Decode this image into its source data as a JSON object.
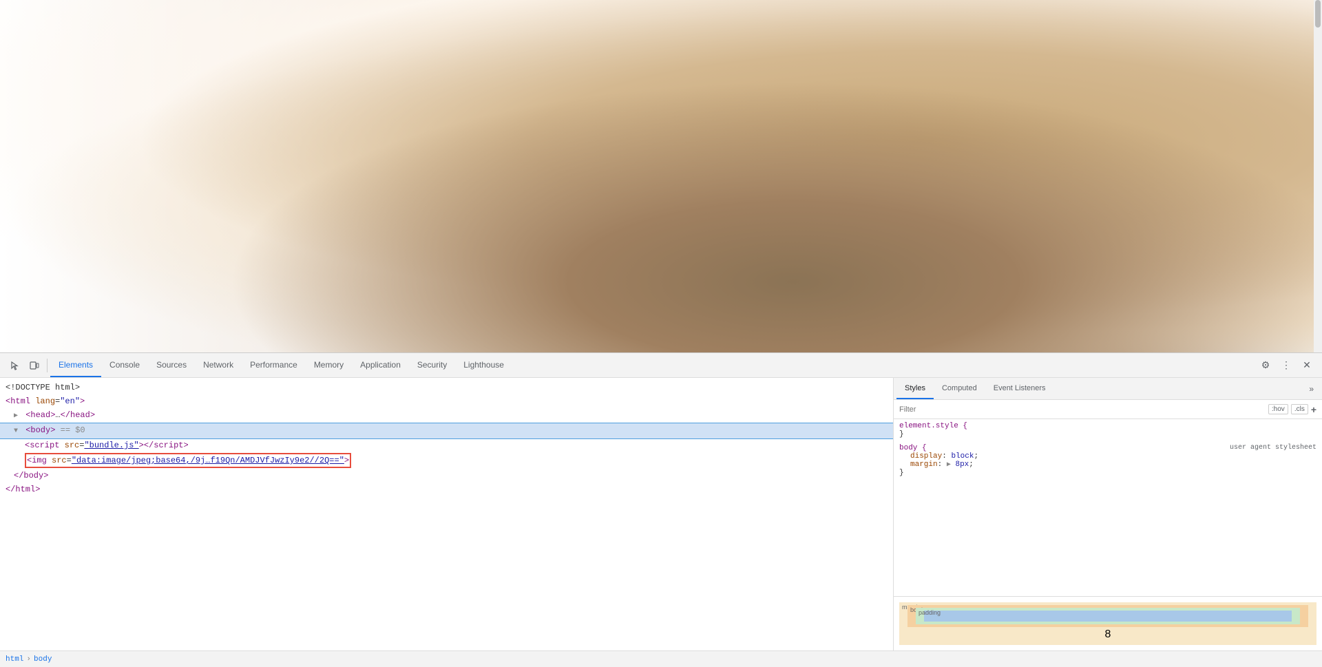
{
  "page": {
    "image_description": "Close-up photo of a person with brown hair"
  },
  "devtools": {
    "tabs": [
      {
        "id": "elements",
        "label": "Elements",
        "active": true
      },
      {
        "id": "console",
        "label": "Console",
        "active": false
      },
      {
        "id": "sources",
        "label": "Sources",
        "active": false
      },
      {
        "id": "network",
        "label": "Network",
        "active": false
      },
      {
        "id": "performance",
        "label": "Performance",
        "active": false
      },
      {
        "id": "memory",
        "label": "Memory",
        "active": false
      },
      {
        "id": "application",
        "label": "Application",
        "active": false
      },
      {
        "id": "security",
        "label": "Security",
        "active": false
      },
      {
        "id": "lighthouse",
        "label": "Lighthouse",
        "active": false
      }
    ],
    "dom": {
      "lines": [
        {
          "indent": 0,
          "content": "<!DOCTYPE html>"
        },
        {
          "indent": 0,
          "html": "<span class='tag-name'>&lt;html</span> <span class='attr-name'>lang</span>=<span class='attr-value'>\"en\"</span><span class='tag-name'>&gt;</span>"
        },
        {
          "indent": 1,
          "html": "<span class='collapse-arrow'>▶</span> <span class='tag-name'>&lt;head&gt;</span>...<span class='tag-name'>&lt;/head&gt;</span>"
        },
        {
          "indent": 1,
          "html": "<span class='collapse-arrow'>▼</span> <span class='tag-name'>&lt;body&gt;</span> == $0",
          "selected": true
        },
        {
          "indent": 2,
          "html": "<span class='tag-name'>&lt;script</span> <span class='attr-name'>src</span>=<span class='attr-value'><span class='link-text'>\"bundle.js\"</span></span><span class='tag-name'>&gt;&lt;/script&gt;</span>"
        },
        {
          "indent": 2,
          "html": "<span class='highlight-box'><span class='tag-name'>&lt;img</span> <span class='attr-name'>src</span>=<span class='attr-value'><span class='link-text'>\"data:image/jpeg;base64,/9j…f19Qn/AMDJVfJwzIy9e2//2Q==\"</span></span><span class='tag-name'>&gt;</span></span>",
          "highlighted": true
        },
        {
          "indent": 1,
          "html": "<span class='tag-name'>&lt;/body&gt;</span>"
        },
        {
          "indent": 0,
          "html": "<span class='tag-name'>&lt;/html&gt;</span>"
        }
      ]
    },
    "styles": {
      "tabs": [
        {
          "label": "Styles",
          "active": true
        },
        {
          "label": "Computed",
          "active": false
        },
        {
          "label": "Event Listeners",
          "active": false
        }
      ],
      "filter": {
        "placeholder": "Filter",
        "hov_label": ":hov",
        "cls_label": ".cls",
        "add_label": "+"
      },
      "rules": [
        {
          "selector": "element.style {",
          "close": "}",
          "properties": []
        },
        {
          "selector": "body {",
          "source": "user agent stylesheet",
          "close": "}",
          "properties": [
            {
              "name": "display:",
              "value": "block;"
            },
            {
              "name": "margin:",
              "value": "▶ 8px;"
            }
          ]
        }
      ]
    },
    "box_model": {
      "margin": "8",
      "border": "",
      "padding": "",
      "content": ""
    }
  },
  "breadcrumb": {
    "items": [
      "html",
      "body"
    ]
  }
}
